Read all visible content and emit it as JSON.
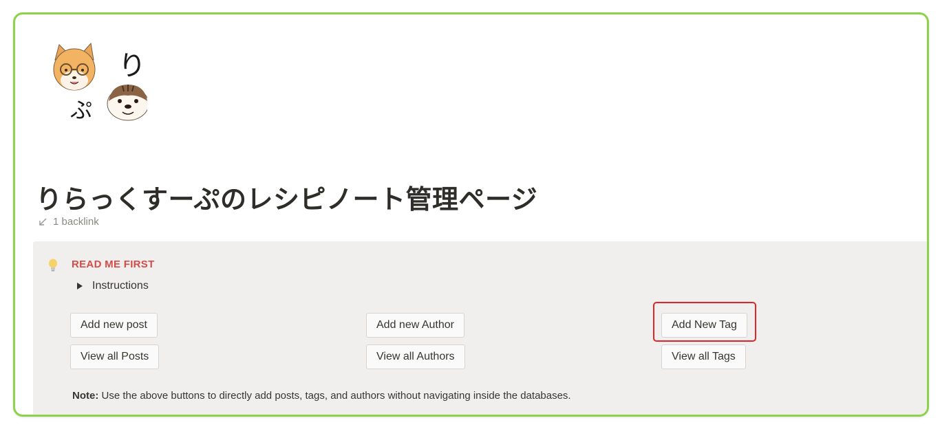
{
  "page": {
    "title": "りらっくすーぷのレシピノート管理ページ",
    "backlink_text": "1 backlink"
  },
  "logo": {
    "chars": [
      "り",
      "ぷ"
    ]
  },
  "callout": {
    "icon": "lightbulb-icon",
    "heading": "READ ME FIRST",
    "heading_color": "#d44c47",
    "toggle_label": "Instructions",
    "buttons": {
      "add_post": "Add new post",
      "view_posts": "View all Posts",
      "add_author": "Add new Author",
      "view_authors": "View all Authors",
      "add_tag": "Add New Tag",
      "view_tags": "View all Tags"
    },
    "note_label": "Note:",
    "note_text": " Use the above buttons to directly add posts, tags, and authors without navigating inside the databases."
  },
  "colors": {
    "frame_border": "#8ed14a",
    "highlight": "#e0242a",
    "callout_bg": "#f1eeee"
  }
}
